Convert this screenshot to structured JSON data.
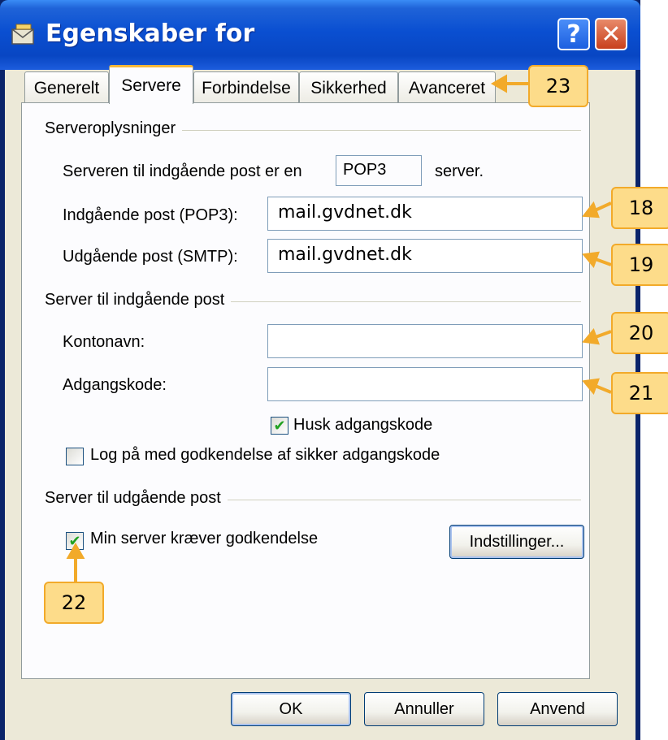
{
  "window": {
    "title": "Egenskaber for",
    "help_glyph": "?",
    "close_glyph": "✕",
    "title_icon": "mail-envelope-icon"
  },
  "tabs": [
    {
      "label": "Generelt",
      "active": false
    },
    {
      "label": "Servere",
      "active": true
    },
    {
      "label": "Forbindelse",
      "active": false
    },
    {
      "label": "Sikkerhed",
      "active": false
    },
    {
      "label": "Avanceret",
      "active": false
    }
  ],
  "server_info": {
    "heading": "Serveroplysninger",
    "incoming_type_prefix": "Serveren til indgående post er en",
    "incoming_type_value": "POP3",
    "incoming_type_suffix": "server.",
    "incoming_label": "Indgående post (POP3):",
    "incoming_value": "mail.gvdnet.dk",
    "outgoing_label": "Udgående post (SMTP):",
    "outgoing_value": "mail.gvdnet.dk"
  },
  "incoming_server": {
    "heading": "Server til indgående post",
    "account_label": "Kontonavn:",
    "account_value": "",
    "password_label": "Adgangskode:",
    "password_value": "",
    "remember_password_label": "Husk adgangskode",
    "remember_password_checked": true,
    "spa_label": "Log på med godkendelse af sikker adgangskode",
    "spa_checked": false
  },
  "outgoing_server": {
    "heading": "Server til udgående post",
    "auth_label": "Min server kræver godkendelse",
    "auth_checked": true,
    "settings_button": "Indstillinger..."
  },
  "buttons": {
    "ok": "OK",
    "cancel": "Annuller",
    "apply": "Anvend"
  },
  "callouts": {
    "c18": "18",
    "c19": "19",
    "c20": "20",
    "c21": "21",
    "c22": "22",
    "c23": "23"
  },
  "colors": {
    "callout_fill": "#fddc8a",
    "callout_border": "#f2aa2a",
    "titlebar": "#0846c3",
    "dialog_bg": "#ece9d8",
    "tab_highlight": "#f8b83a",
    "check_green": "#21a121"
  }
}
